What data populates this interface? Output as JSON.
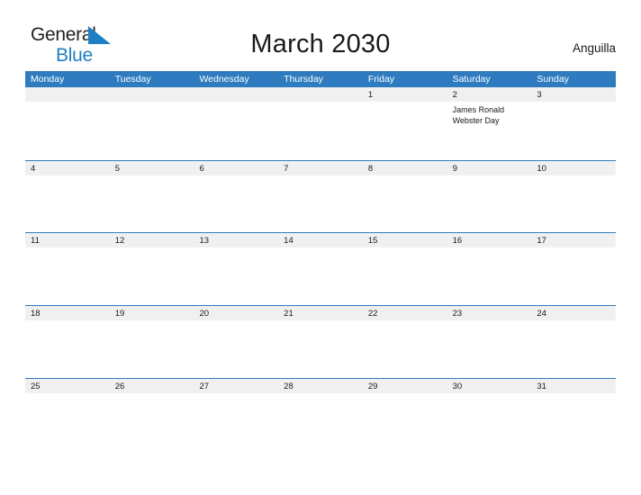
{
  "brand": {
    "name_part1": "General",
    "name_part2": "Blue",
    "flag_icon": "blue-flag-triangle-icon",
    "accent_color": "#1f7fc4"
  },
  "header": {
    "title": "March 2030",
    "region": "Anguilla"
  },
  "theme": {
    "header_blue": "#2e7cbf",
    "band_gray": "#f0f0f0",
    "page_background": "#ffffff",
    "text_color": "#1a1a1a"
  },
  "calendar": {
    "month": "March",
    "year": "2030",
    "weekday_headers": [
      "Monday",
      "Tuesday",
      "Wednesday",
      "Thursday",
      "Friday",
      "Saturday",
      "Sunday"
    ],
    "weeks": [
      [
        {
          "date": "",
          "events": []
        },
        {
          "date": "",
          "events": []
        },
        {
          "date": "",
          "events": []
        },
        {
          "date": "",
          "events": []
        },
        {
          "date": "1",
          "events": []
        },
        {
          "date": "2",
          "events": [
            "James Ronald Webster Day"
          ]
        },
        {
          "date": "3",
          "events": []
        }
      ],
      [
        {
          "date": "4",
          "events": []
        },
        {
          "date": "5",
          "events": []
        },
        {
          "date": "6",
          "events": []
        },
        {
          "date": "7",
          "events": []
        },
        {
          "date": "8",
          "events": []
        },
        {
          "date": "9",
          "events": []
        },
        {
          "date": "10",
          "events": []
        }
      ],
      [
        {
          "date": "11",
          "events": []
        },
        {
          "date": "12",
          "events": []
        },
        {
          "date": "13",
          "events": []
        },
        {
          "date": "14",
          "events": []
        },
        {
          "date": "15",
          "events": []
        },
        {
          "date": "16",
          "events": []
        },
        {
          "date": "17",
          "events": []
        }
      ],
      [
        {
          "date": "18",
          "events": []
        },
        {
          "date": "19",
          "events": []
        },
        {
          "date": "20",
          "events": []
        },
        {
          "date": "21",
          "events": []
        },
        {
          "date": "22",
          "events": []
        },
        {
          "date": "23",
          "events": []
        },
        {
          "date": "24",
          "events": []
        }
      ],
      [
        {
          "date": "25",
          "events": []
        },
        {
          "date": "26",
          "events": []
        },
        {
          "date": "27",
          "events": []
        },
        {
          "date": "28",
          "events": []
        },
        {
          "date": "29",
          "events": []
        },
        {
          "date": "30",
          "events": []
        },
        {
          "date": "31",
          "events": []
        }
      ]
    ]
  }
}
